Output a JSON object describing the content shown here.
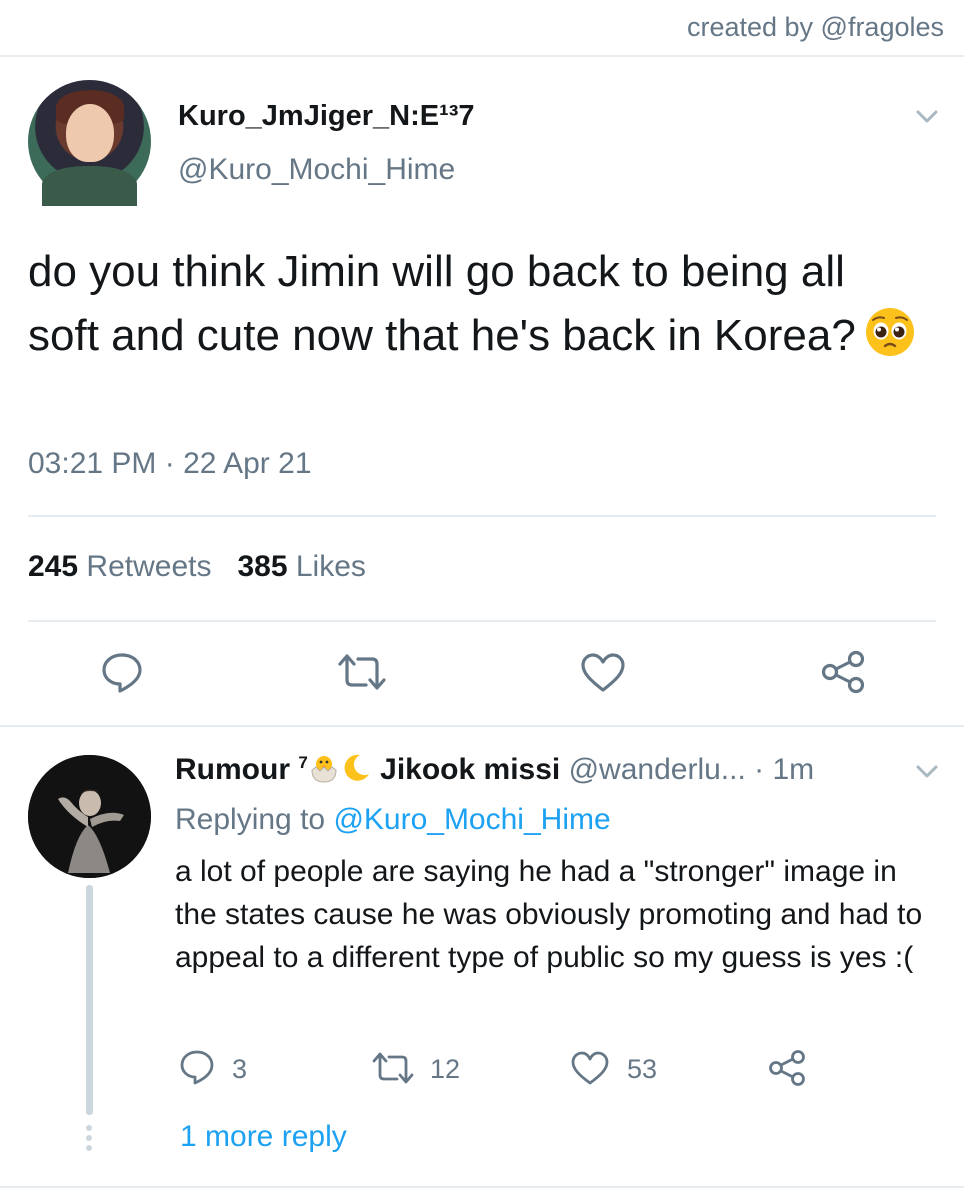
{
  "credit": "created by @fragoles",
  "tweet": {
    "display_name": "Kuro_JmJiger_⁣N:E¹³7",
    "handle": "@Kuro_Mochi_Hime",
    "text": "do you think Jimin will go back to being all soft and cute now that he's back in Korea?",
    "emoji": "pleading-face",
    "timestamp": "03:21 PM · 22 Apr 21",
    "retweets_count": "245",
    "retweets_label": "Retweets",
    "likes_count": "385",
    "likes_label": "Likes"
  },
  "reply": {
    "display_name": "Rumour",
    "name_superscript": "7",
    "name_emojis": [
      "hatching-chick",
      "crescent-moon"
    ],
    "name_suffix": "Jikook missi",
    "handle": "@wanderlu...",
    "time": "· 1m",
    "replying_prefix": "Replying to",
    "replying_handle": "@Kuro_Mochi_Hime",
    "text": "a lot of people are saying he had a \"stronger\" image in the states cause he was obviously promoting and had to appeal to a different type of public so my guess is yes :(",
    "reply_count": "3",
    "retweet_count": "12",
    "like_count": "53",
    "more_replies": "1 more reply"
  },
  "colors": {
    "text": "#14171a",
    "secondary": "#657786",
    "link": "#1da1f2",
    "divider": "#e6ecf0"
  }
}
